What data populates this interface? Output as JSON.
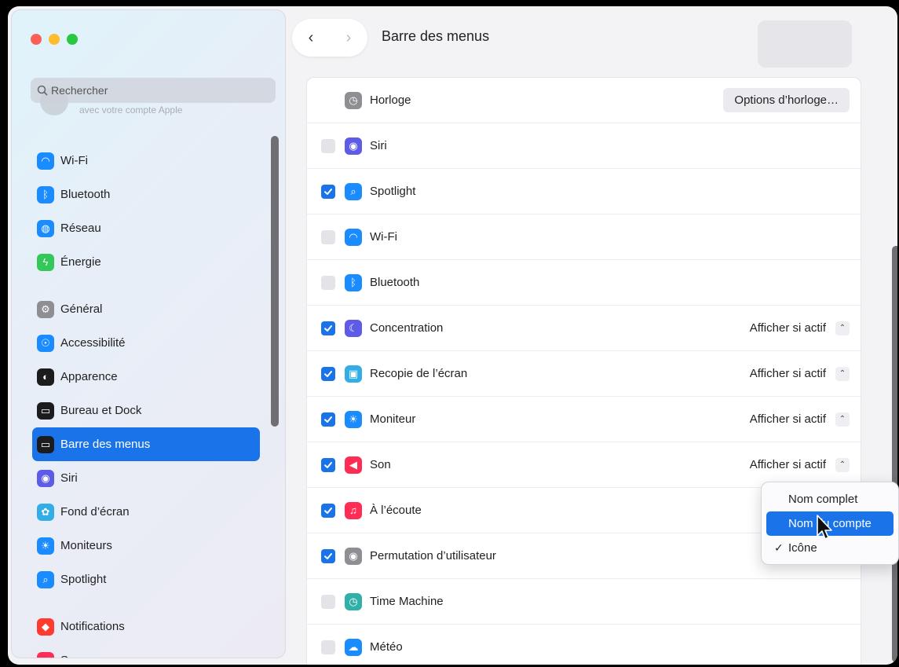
{
  "window": {
    "title": "Barre des menus"
  },
  "sidebar": {
    "search_placeholder": "Rechercher",
    "account_ghost_text": "avec votre compte Apple",
    "items": [
      {
        "label": "Wi-Fi",
        "icon": "wifi-icon",
        "color": "#1a8cff"
      },
      {
        "label": "Bluetooth",
        "icon": "bluetooth-icon",
        "color": "#1a8cff"
      },
      {
        "label": "Réseau",
        "icon": "globe-icon",
        "color": "#1a8cff"
      },
      {
        "label": "Énergie",
        "icon": "battery-icon",
        "color": "#34c759"
      },
      {
        "label": "Général",
        "icon": "gear-icon",
        "color": "#8e8e93"
      },
      {
        "label": "Accessibilité",
        "icon": "accessibility-icon",
        "color": "#1a8cff"
      },
      {
        "label": "Apparence",
        "icon": "appearance-icon",
        "color": "#1c1c1e"
      },
      {
        "label": "Bureau et Dock",
        "icon": "dock-icon",
        "color": "#1c1c1e"
      },
      {
        "label": "Barre des menus",
        "icon": "menubar-icon",
        "color": "#1c1c1e"
      },
      {
        "label": "Siri",
        "icon": "siri-icon",
        "color": "#5e5ce6"
      },
      {
        "label": "Fond d’écran",
        "icon": "wallpaper-icon",
        "color": "#32ade6"
      },
      {
        "label": "Moniteurs",
        "icon": "display-icon",
        "color": "#1a8cff"
      },
      {
        "label": "Spotlight",
        "icon": "spotlight-icon",
        "color": "#1a8cff"
      },
      {
        "label": "Notifications",
        "icon": "notifications-icon",
        "color": "#ff3b30"
      },
      {
        "label": "Son",
        "icon": "sound-icon",
        "color": "#ff2d55"
      }
    ]
  },
  "main": {
    "clock": {
      "label": "Horloge",
      "button": "Options d’horloge…"
    },
    "rows": [
      {
        "label": "Siri",
        "checked": false,
        "icon": "siri-icon",
        "color": "#5e5ce6",
        "select": ""
      },
      {
        "label": "Spotlight",
        "checked": true,
        "icon": "spotlight-icon",
        "color": "#1a8cff",
        "select": ""
      },
      {
        "label": "Wi-Fi",
        "checked": false,
        "icon": "wifi-icon",
        "color": "#1a8cff",
        "select": ""
      },
      {
        "label": "Bluetooth",
        "checked": false,
        "icon": "bluetooth-icon",
        "color": "#1a8cff",
        "select": ""
      },
      {
        "label": "Concentration",
        "checked": true,
        "icon": "moon-icon",
        "color": "#5e5ce6",
        "select": "Afficher si actif"
      },
      {
        "label": "Recopie de l’écran",
        "checked": true,
        "icon": "screen-mirroring-icon",
        "color": "#32ade6",
        "select": "Afficher si actif"
      },
      {
        "label": "Moniteur",
        "checked": true,
        "icon": "display-icon",
        "color": "#1a8cff",
        "select": "Afficher si actif"
      },
      {
        "label": "Son",
        "checked": true,
        "icon": "sound-icon",
        "color": "#ff2d55",
        "select": "Afficher si actif"
      },
      {
        "label": "À l’écoute",
        "checked": true,
        "icon": "now-listening-icon",
        "color": "#ff2d55",
        "select": "Affiche"
      },
      {
        "label": "Permutation d’utilisateur",
        "checked": true,
        "icon": "user-icon",
        "color": "#8e8e93",
        "select": ""
      },
      {
        "label": "Time Machine",
        "checked": false,
        "icon": "time-machine-icon",
        "color": "#30b0a8",
        "select": ""
      },
      {
        "label": "Météo",
        "checked": false,
        "icon": "weather-icon",
        "color": "#1a8cff",
        "select": ""
      }
    ]
  },
  "popup": {
    "options": [
      {
        "label": "Nom complet",
        "checked": false,
        "highlighted": false
      },
      {
        "label": "Nom du compte",
        "checked": false,
        "highlighted": true
      },
      {
        "label": "Icône",
        "checked": true,
        "highlighted": false
      }
    ],
    "check_glyph": "✓"
  }
}
